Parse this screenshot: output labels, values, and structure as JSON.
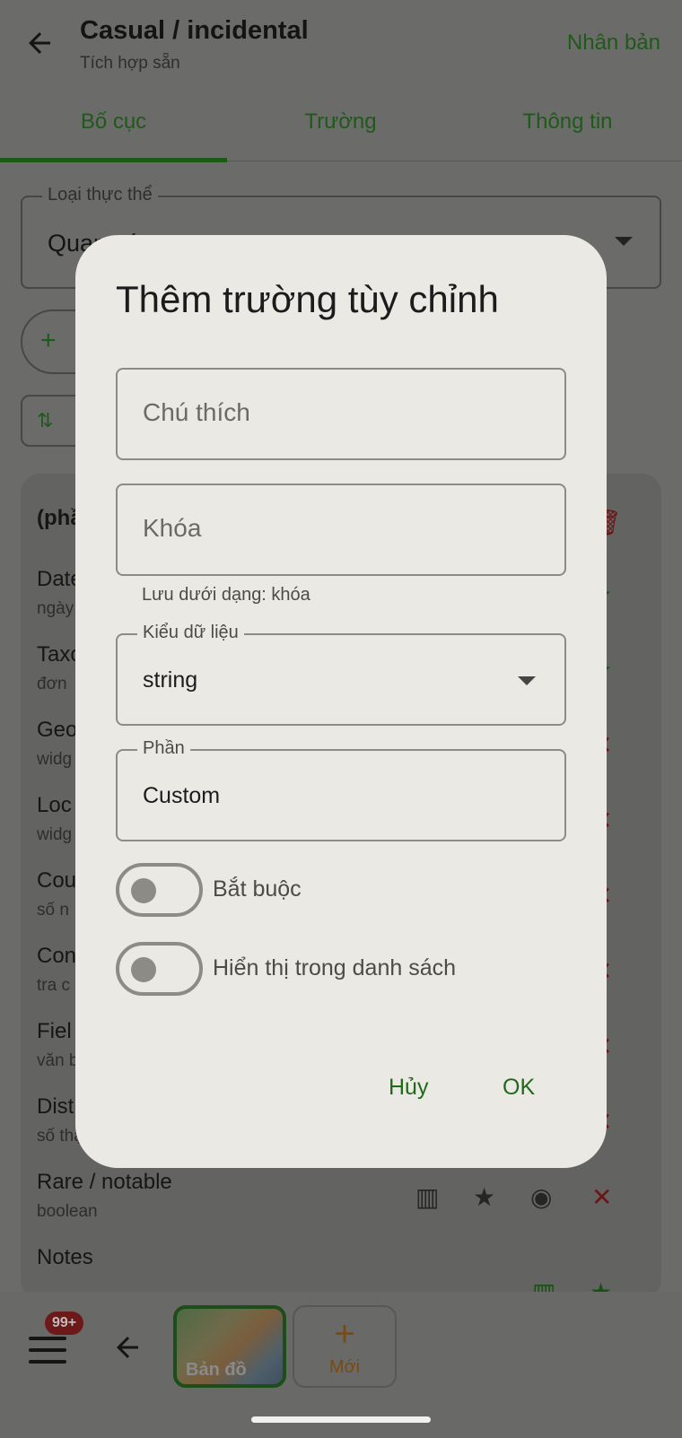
{
  "topbar": {
    "title": "Casual / incidental",
    "subtitle": "Tích hợp sẵn",
    "action": "Nhân bản"
  },
  "tabs": [
    "Bố cục",
    "Trường",
    "Thông tin"
  ],
  "entity_type": {
    "label": "Loại thực thể",
    "value_visible": "Quan sát"
  },
  "field_rows": [
    {
      "title": "Date",
      "sub": "ngày"
    },
    {
      "title": "Taxon",
      "sub": "đơn"
    },
    {
      "title": "Geo",
      "sub": "widg"
    },
    {
      "title": "Loc",
      "sub": "widg"
    },
    {
      "title": "Cou",
      "sub": "số n"
    },
    {
      "title": "Con",
      "sub": "tra c"
    },
    {
      "title": "Fiel",
      "sub": "văn b"
    },
    {
      "title": "Dist",
      "sub": "số thập"
    },
    {
      "title": "Rare / notable",
      "sub": "boolean"
    },
    {
      "title": "Notes",
      "sub": ""
    }
  ],
  "section_header": "(phần",
  "bottom": {
    "badge": "99+",
    "map_label": "Bản đồ",
    "new_label": "Mới"
  },
  "dialog": {
    "title": "Thêm trường tùy chỉnh",
    "caption_placeholder": "Chú thích",
    "key_placeholder": "Khóa",
    "helper": "Lưu dưới dạng: khóa",
    "datatype_label": "Kiểu dữ liệu",
    "datatype_value": "string",
    "section_label": "Phần",
    "section_value": "Custom",
    "required_label": "Bắt buộc",
    "required_on": false,
    "show_in_list_label": "Hiển thị trong danh sách",
    "show_in_list_on": false,
    "cancel": "Hủy",
    "ok": "OK"
  }
}
